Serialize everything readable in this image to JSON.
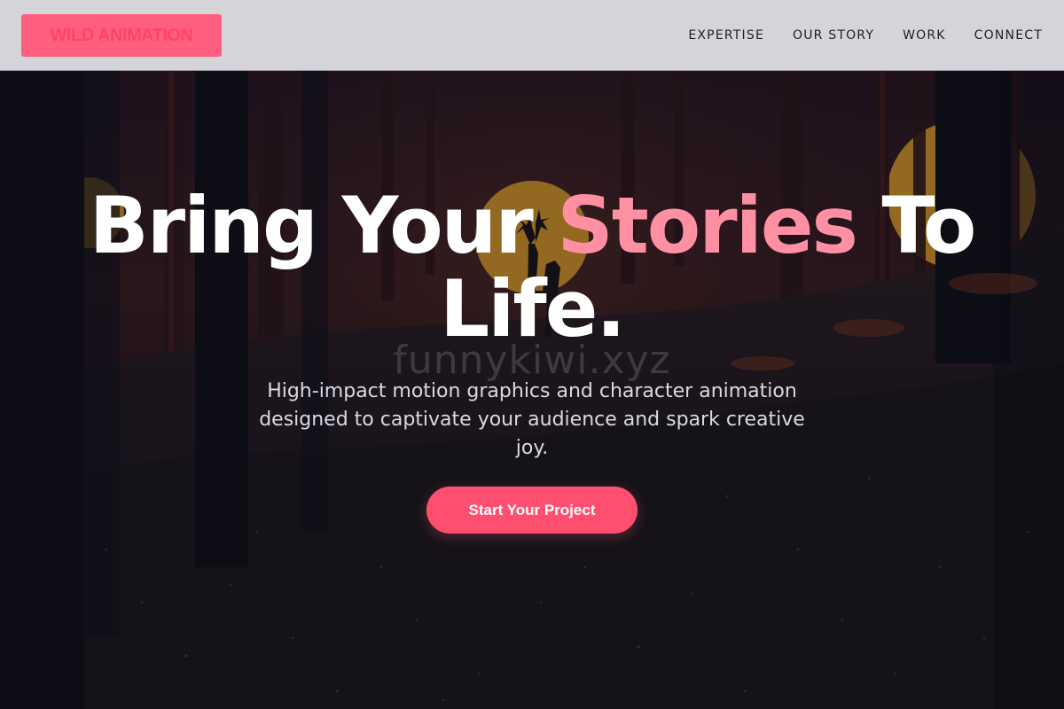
{
  "header": {
    "logo_text": "WILD ANIMATION",
    "nav": [
      {
        "label": "EXPERTISE"
      },
      {
        "label": "OUR STORY"
      },
      {
        "label": "WORK"
      },
      {
        "label": "CONNECT"
      }
    ]
  },
  "hero": {
    "headline_part1": "Bring Your ",
    "headline_accent": "Stories",
    "headline_part2": " To Life.",
    "watermark": "funnykiwi.xyz",
    "subtitle": "High-impact motion graphics and character animation designed to captivate your audience and spark creative joy.",
    "cta_label": "Start Your Project"
  },
  "colors": {
    "accent": "#ff4f70",
    "accent_light": "#ff8fa3",
    "header_bg": "#d5d5d9",
    "nav_text": "#1e1e2e"
  }
}
